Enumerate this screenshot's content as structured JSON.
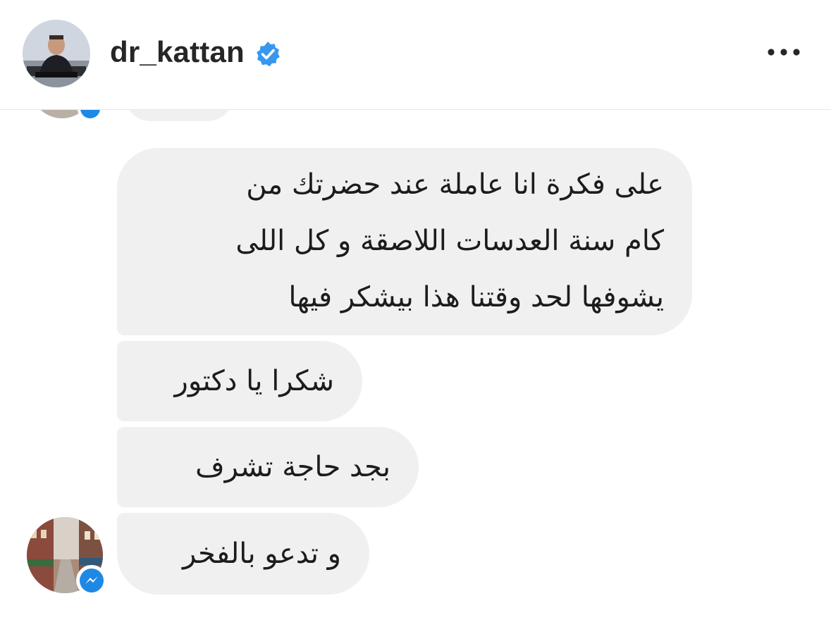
{
  "header": {
    "username": "dr_kattan",
    "verified_icon": "verified-badge-icon",
    "more_icon": "more-horizontal-icon",
    "avatar_icon": "profile-avatar-icon"
  },
  "messages": [
    {
      "lines": [
        "على فكرة انا عاملة عند حضرتك من",
        "كام سنة العدسات اللاصقة و كل اللى",
        "يشوفها لحد وقتنا هذا بيشكر فيها"
      ]
    },
    {
      "lines": [
        "شكرا يا دكتور"
      ]
    },
    {
      "lines": [
        "بجد حاجة تشرف"
      ]
    },
    {
      "lines": [
        "و تدعو بالفخر"
      ]
    }
  ],
  "sender": {
    "avatar_icon": "sender-avatar-icon",
    "badge_icon": "messenger-badge-icon"
  },
  "colors": {
    "bubble": "#f0f0f0",
    "verified": "#3897f0",
    "messenger": "#1e88e5",
    "text": "#262626"
  }
}
